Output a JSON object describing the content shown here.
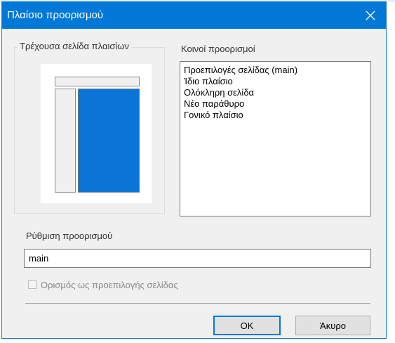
{
  "window": {
    "title": "Πλαίσιο προορισμού",
    "accent_color": "#0078d7",
    "close_icon": "close-icon"
  },
  "current_frames": {
    "label": "Τρέχουσα σελίδα πλαισίων",
    "selected_frame_color": "#0a74d7"
  },
  "common_targets": {
    "label": "Κοινοί προορισμοί",
    "items": [
      "Προεπιλογές σελίδας (main)",
      "Ίδιο πλαίσιο",
      "Ολόκληρη σελίδα",
      "Νέο παράθυρο",
      "Γονικό πλαίσιο"
    ]
  },
  "target_setting": {
    "label": "Ρύθμιση προορισμού",
    "value": "main"
  },
  "default_checkbox": {
    "label": "Ορισμός ως προεπιλογής σελίδας",
    "checked": false,
    "disabled": true
  },
  "buttons": {
    "ok": "OK",
    "cancel": "Άκυρο"
  }
}
